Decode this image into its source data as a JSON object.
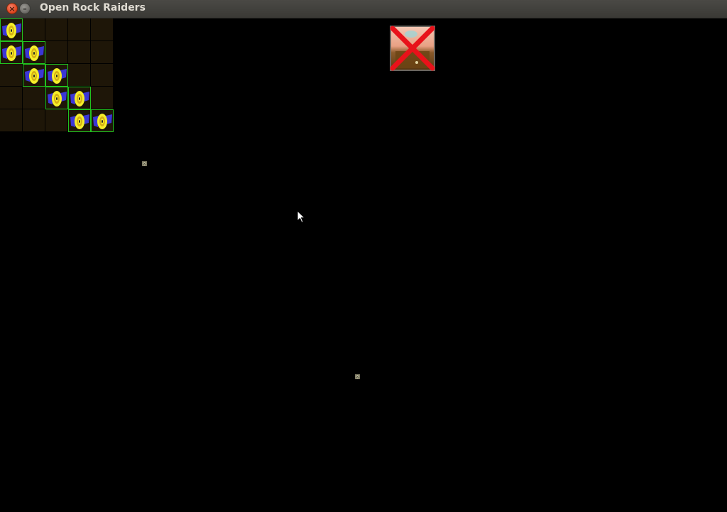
{
  "window": {
    "title": "Open Rock Raiders",
    "close_label": "×",
    "minimize_label": "–"
  },
  "game": {
    "tile_grid": {
      "rows": 5,
      "cols": 5,
      "ore_tiles": [
        [
          0,
          0
        ],
        [
          1,
          0
        ],
        [
          1,
          1
        ],
        [
          2,
          1
        ],
        [
          2,
          2
        ],
        [
          3,
          2
        ],
        [
          3,
          3
        ],
        [
          4,
          3
        ],
        [
          4,
          4
        ]
      ]
    },
    "selected_unit_portrait": {
      "icon": "rock-raider-portrait-icon",
      "status": "cancelled"
    },
    "map_markers": [
      {
        "icon": "waypoint-marker-icon"
      },
      {
        "icon": "waypoint-marker-icon"
      }
    ]
  },
  "colors": {
    "background": "#000000",
    "tile_fill": "#1e1608",
    "selection_border": "#21c21f",
    "ore_yellow": "#f5ee2a",
    "ore_blue": "#3b37d6",
    "cancel_red": "#e8121a"
  }
}
